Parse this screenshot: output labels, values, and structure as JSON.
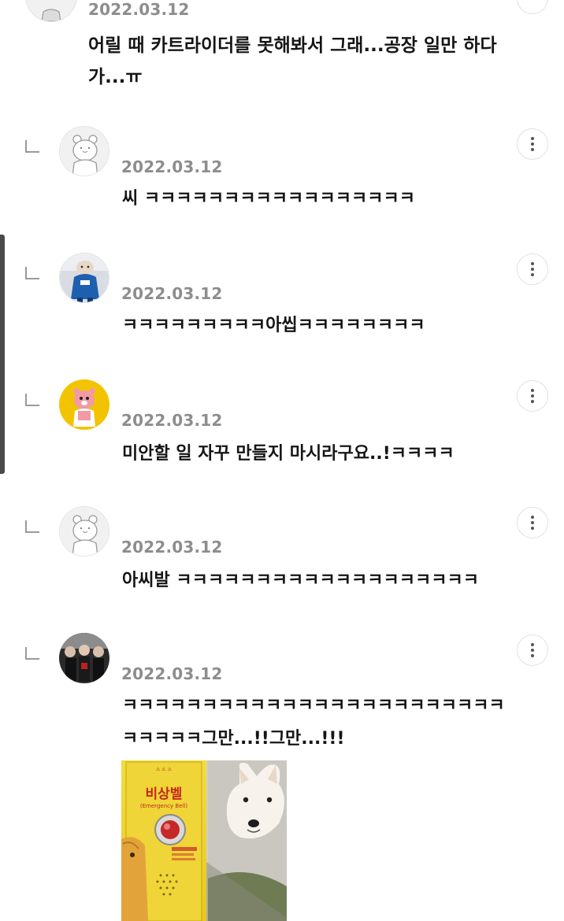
{
  "top_comment": {
    "date": "2022.03.12",
    "text": "어릴 때 카트라이더를 못해봐서 그래...공장 일만 하다가...ㅠ"
  },
  "replies": [
    {
      "nickname": "",
      "date": "2022.03.12",
      "text": "씨 ㅋㅋㅋㅋㅋㅋㅋㅋㅋㅋㅋㅋㅋㅋㅋㅋㅋ",
      "avatar": "default-bear-avatar"
    },
    {
      "nickname": "",
      "date": "2022.03.12",
      "text": "ㅋㅋㅋㅋㅋㅋㅋㅋㅋ아씹ㅋㅋㅋㅋㅋㅋㅋㅋ",
      "avatar": "bulldog-mascot-avatar"
    },
    {
      "nickname": "",
      "date": "2022.03.12",
      "text": "미안할 일 자꾸 만들지 마시라구요..!ㅋㅋㅋㅋ",
      "avatar": "loopy-avatar"
    },
    {
      "nickname": "",
      "date": "2022.03.12",
      "text": "아씨발 ㅋㅋㅋㅋㅋㅋㅋㅋㅋㅋㅋㅋㅋㅋㅋㅋㅋㅋㅋ",
      "avatar": "default-bear-avatar"
    },
    {
      "nickname": "",
      "date": "2022.03.12",
      "text": "ㅋㅋㅋㅋㅋㅋㅋㅋㅋㅋㅋㅋㅋㅋㅋㅋㅋㅋㅋㅋㅋㅋㅋㅋㅋㅋㅋㅋㅋ그만...!!그만...!!!",
      "avatar": "group-photo-avatar"
    }
  ],
  "attached_image": {
    "sign_text": "비상벨",
    "sign_subtext": "(Emergency Bell)"
  },
  "colors": {
    "date_gray": "#8d8d8d",
    "text_black": "#151515",
    "border_gray": "#e2e2e2",
    "avatar_yellow": "#f2c400"
  }
}
